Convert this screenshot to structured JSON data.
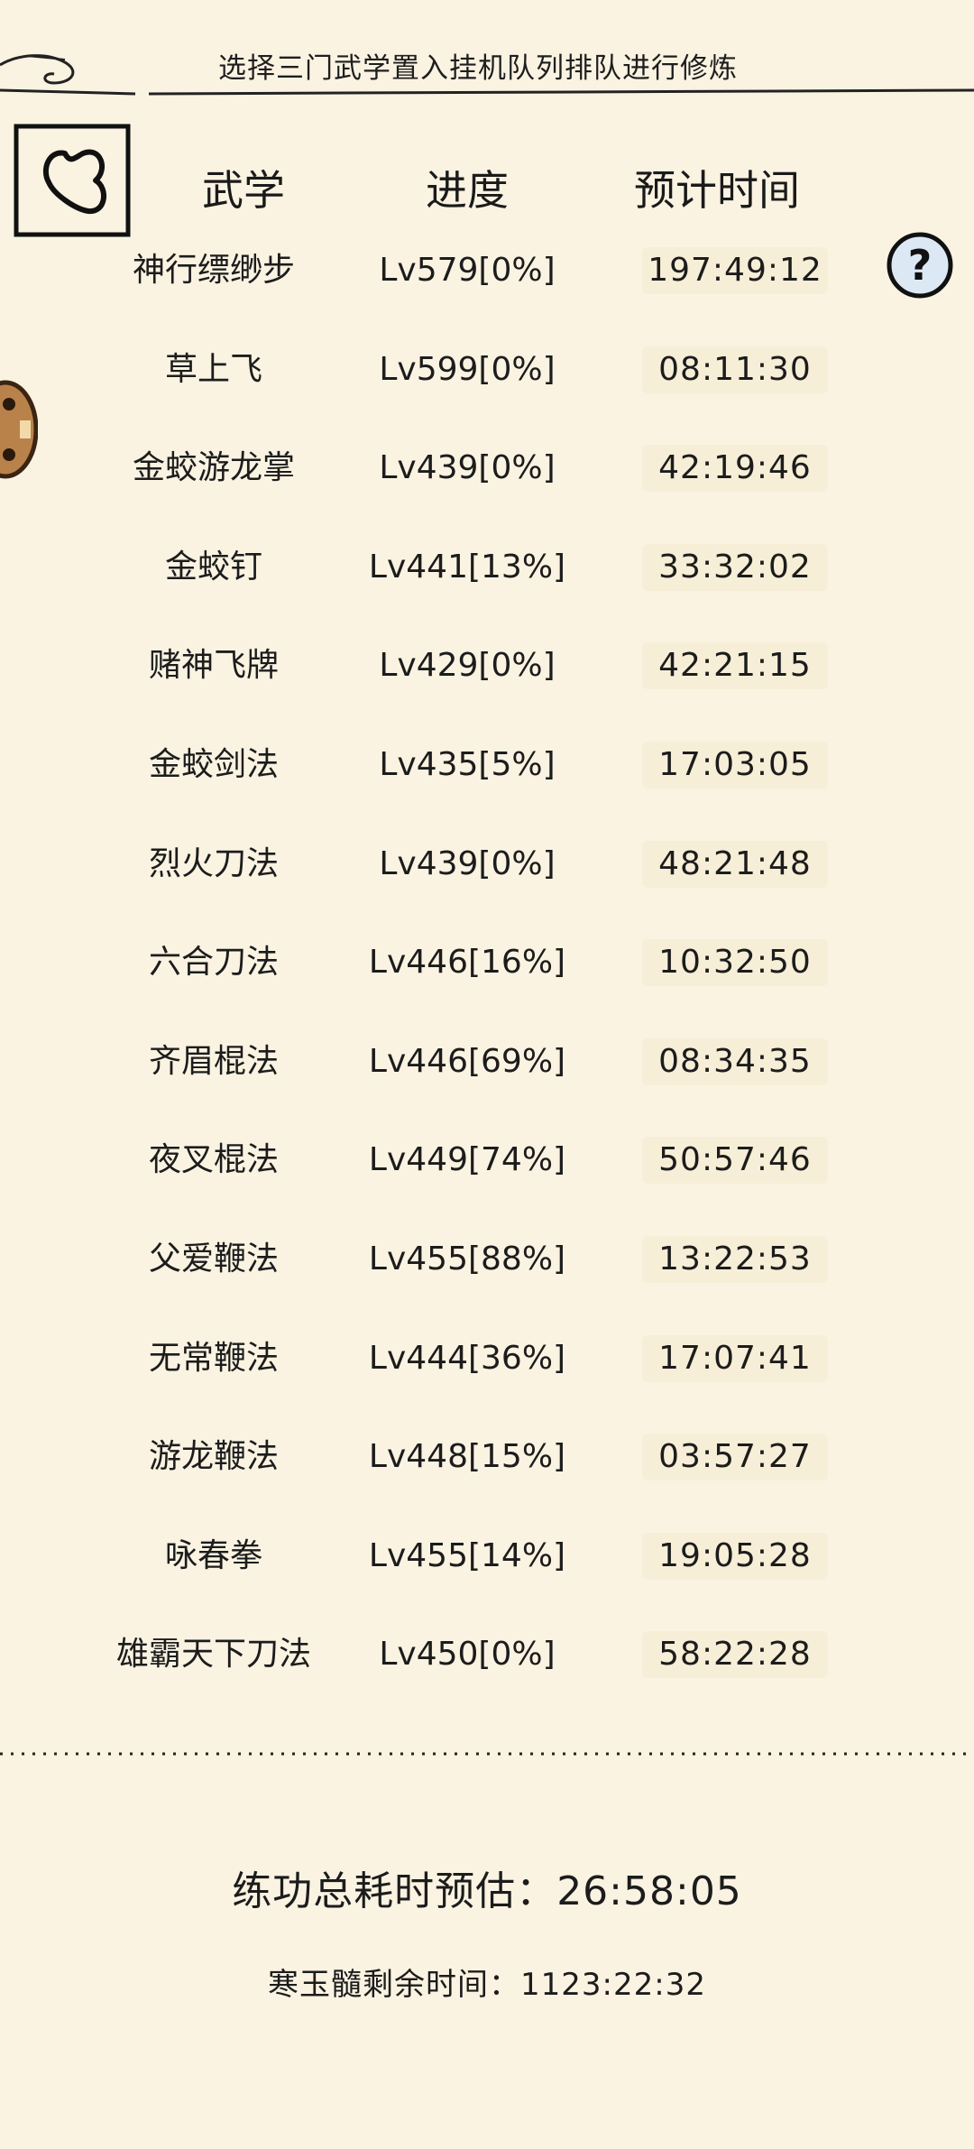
{
  "header": {
    "title": "选择三门武学置入挂机队列排队进行修炼"
  },
  "columns": {
    "name": "武学",
    "progress": "进度",
    "time": "预计时间"
  },
  "rows": [
    {
      "name": "神行缥缈步",
      "progress": "Lv579[0%]",
      "time": "197:49:12"
    },
    {
      "name": "草上飞",
      "progress": "Lv599[0%]",
      "time": "08:11:30"
    },
    {
      "name": "金蛟游龙掌",
      "progress": "Lv439[0%]",
      "time": "42:19:46"
    },
    {
      "name": "金蛟钉",
      "progress": "Lv441[13%]",
      "time": "33:32:02"
    },
    {
      "name": "赌神飞牌",
      "progress": "Lv429[0%]",
      "time": "42:21:15"
    },
    {
      "name": "金蛟剑法",
      "progress": "Lv435[5%]",
      "time": "17:03:05"
    },
    {
      "name": "烈火刀法",
      "progress": "Lv439[0%]",
      "time": "48:21:48"
    },
    {
      "name": "六合刀法",
      "progress": "Lv446[16%]",
      "time": "10:32:50"
    },
    {
      "name": "齐眉棍法",
      "progress": "Lv446[69%]",
      "time": "08:34:35"
    },
    {
      "name": "夜叉棍法",
      "progress": "Lv449[74%]",
      "time": "50:57:46"
    },
    {
      "name": "父爱鞭法",
      "progress": "Lv455[88%]",
      "time": "13:22:53"
    },
    {
      "name": "无常鞭法",
      "progress": "Lv444[36%]",
      "time": "17:07:41"
    },
    {
      "name": "游龙鞭法",
      "progress": "Lv448[15%]",
      "time": "03:57:27"
    },
    {
      "name": "咏春拳",
      "progress": "Lv455[14%]",
      "time": "19:05:28"
    },
    {
      "name": "雄霸天下刀法",
      "progress": "Lv450[0%]",
      "time": "58:22:28"
    }
  ],
  "footer": {
    "total_label": "练功总耗时预估：",
    "total_value": "26:58:05",
    "remain_label": "寒玉髓剩余时间：",
    "remain_value": "1123:22:32"
  },
  "icons": {
    "back": "back-arrow-icon",
    "help": "question-mark-icon",
    "side": "side-tab-icon"
  },
  "colors": {
    "background": "#faf3e2",
    "ink": "#1c1c1c",
    "help_fill": "#dce9f5",
    "side_tab": "#b9824a"
  }
}
